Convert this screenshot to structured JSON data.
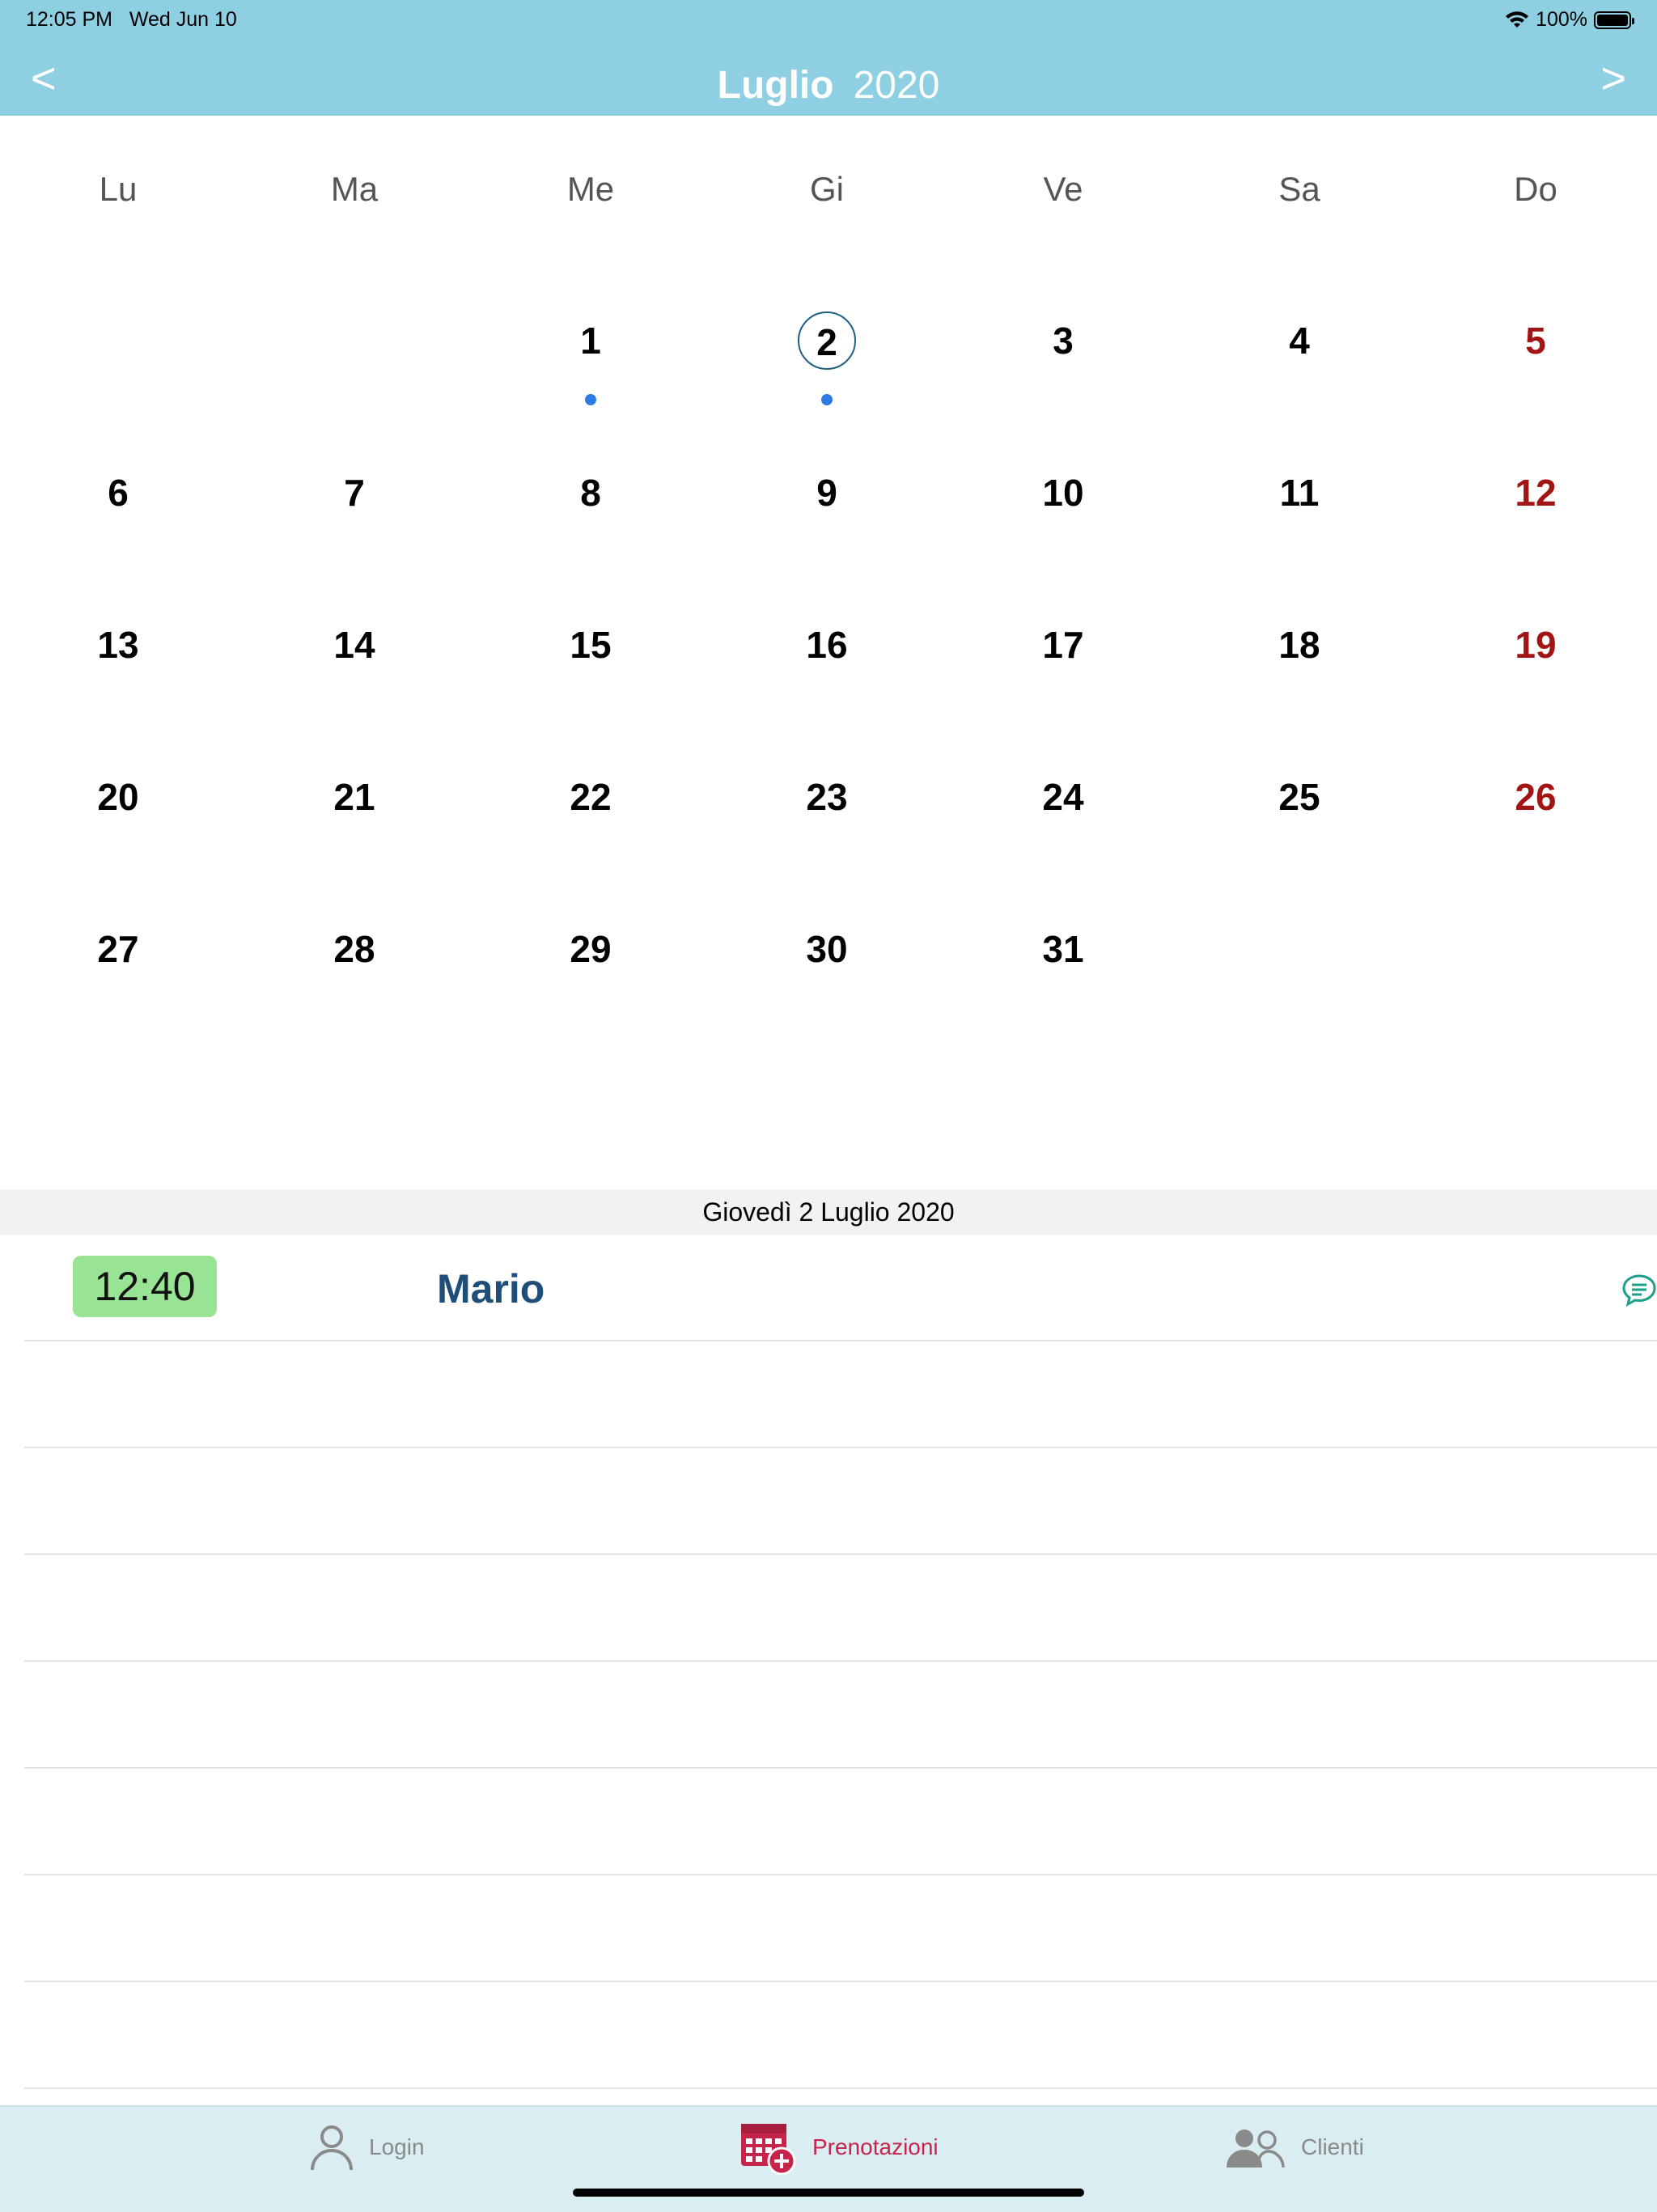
{
  "status_bar": {
    "time": "12:05 PM",
    "date": "Wed Jun 10",
    "battery": "100%"
  },
  "header": {
    "prev": "<",
    "next": ">",
    "month": "Luglio",
    "year": "2020",
    "bg_color": "#8fcfe2"
  },
  "weekdays": [
    "Lu",
    "Ma",
    "Me",
    "Gi",
    "Ve",
    "Sa",
    "Do"
  ],
  "weeks": [
    [
      "",
      "",
      "1",
      "2",
      "3",
      "4",
      "5"
    ],
    [
      "6",
      "7",
      "8",
      "9",
      "10",
      "11",
      "12"
    ],
    [
      "13",
      "14",
      "15",
      "16",
      "17",
      "18",
      "19"
    ],
    [
      "20",
      "21",
      "22",
      "23",
      "24",
      "25",
      "26"
    ],
    [
      "27",
      "28",
      "29",
      "30",
      "31",
      "",
      ""
    ]
  ],
  "selected_day": "2",
  "days_with_events": [
    "1",
    "2"
  ],
  "selected_date_label": "Giovedì 2 Luglio 2020",
  "appointments": [
    {
      "time": "12:40",
      "client": "Mario",
      "icon": "chat-icon"
    }
  ],
  "tabs": [
    {
      "label": "Login",
      "icon": "person-icon",
      "active": false
    },
    {
      "label": "Prenotazioni",
      "icon": "calendar-add-icon",
      "active": true
    },
    {
      "label": "Clienti",
      "icon": "people-icon",
      "active": false
    }
  ],
  "colors": {
    "sunday": "#a31515",
    "selected_ring": "#1f5f84",
    "event_dot": "#2c7be5",
    "time_badge": "#98e394",
    "client_name": "#1f4e79",
    "active_tab": "#c6244a"
  }
}
